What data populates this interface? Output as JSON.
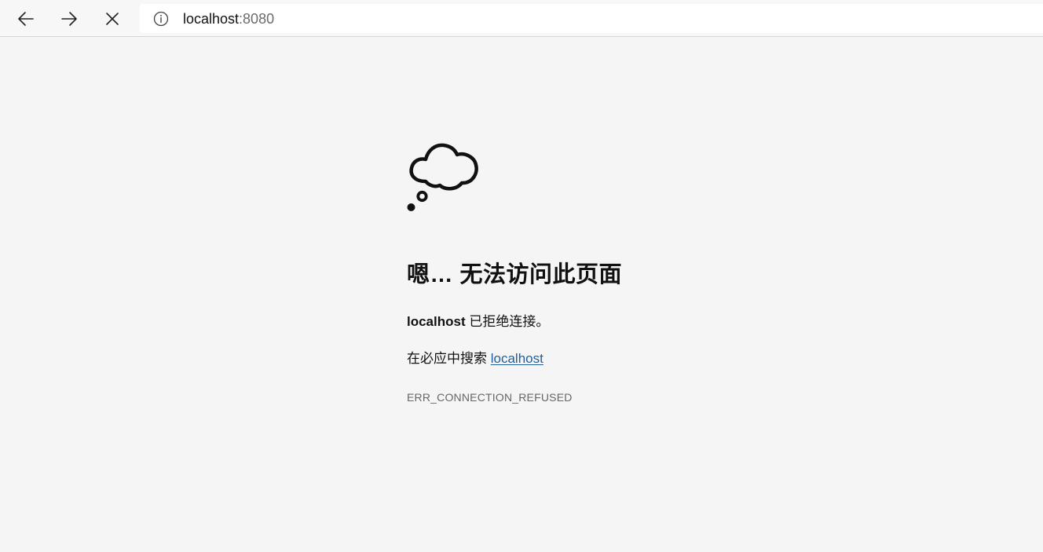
{
  "browser": {
    "icons": {
      "back": "arrow-left-icon",
      "forward": "arrow-right-icon",
      "stop": "close-icon",
      "site_info": "info-icon"
    },
    "address": {
      "host": "localhost",
      "port": ":8080"
    }
  },
  "error_page": {
    "illustration": "thought-cloud-icon",
    "title": "嗯… 无法访问此页面",
    "message_host": "localhost",
    "message_rest": " 已拒绝连接。",
    "search_prefix": "在必应中搜索 ",
    "search_link": "localhost",
    "error_code": "ERR_CONNECTION_REFUSED"
  },
  "colors": {
    "page_bg": "#f5f5f5",
    "link": "#1f5f9c",
    "error_code": "#666666"
  }
}
